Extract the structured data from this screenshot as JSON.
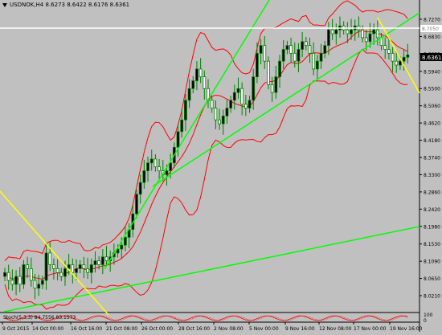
{
  "title": {
    "symbol": "USDNOK,H4",
    "ohlc": "8.6273 8.6422 8.6176 8.6361"
  },
  "indicator_label": "Stoch(5,3,3) 84.7556 83.1573",
  "current_price": "8.6361",
  "hline_price_label": "8.7050",
  "colors": {
    "background": "#c0c0c0",
    "candle": "#008000",
    "band": "#ff0000",
    "trend_green": "#00ff00",
    "trend_yellow": "#ffff00",
    "hline": "#ffffff",
    "price_tag": "#000000"
  },
  "chart_data": {
    "type": "candlestick",
    "title": "USDNOK,H4",
    "ylim": [
      6.0,
      8.76
    ],
    "y_ticks": [
      "8.7270",
      "8.6830",
      "8.6390",
      "8.5940",
      "8.5500",
      "8.5060",
      "8.4620",
      "8.4180",
      "8.3740",
      "8.3300",
      "8.2860",
      "8.2420",
      "8.1980",
      "8.1530",
      "8.1090",
      "8.0650",
      "8.0210"
    ],
    "x_ticks": [
      "9 Oct 2015",
      "14 Oct 00:00",
      "16 Oct 16:00",
      "21 Oct 08:00",
      "26 Oct 00:00",
      "28 Oct 16:00",
      "2 Nov 08:00",
      "5 Nov 00:00",
      "9 Nov 16:00",
      "12 Nov 08:00",
      "17 Nov 00:00",
      "19 Nov 16:00"
    ],
    "sub_ticks": [
      "100",
      "0"
    ],
    "current": 8.6361,
    "hline": 8.705,
    "close_series": [
      8.08,
      8.06,
      8.05,
      8.07,
      8.05,
      8.1,
      8.09,
      8.06,
      8.04,
      8.05,
      8.06,
      8.13,
      8.1,
      8.09,
      8.08,
      8.07,
      8.09,
      8.1,
      8.08,
      8.09,
      8.1,
      8.09,
      8.08,
      8.1,
      8.11,
      8.1,
      8.12,
      8.11,
      8.12,
      8.13,
      8.14,
      8.15,
      8.17,
      8.19,
      8.23,
      8.28,
      8.31,
      8.34,
      8.36,
      8.37,
      8.35,
      8.34,
      8.33,
      8.34,
      8.36,
      8.4,
      8.44,
      8.47,
      8.52,
      8.55,
      8.57,
      8.6,
      8.58,
      8.55,
      8.52,
      8.5,
      8.47,
      8.46,
      8.48,
      8.5,
      8.52,
      8.54,
      8.55,
      8.51,
      8.5,
      8.52,
      8.58,
      8.64,
      8.66,
      8.62,
      8.56,
      8.54,
      8.58,
      8.62,
      8.65,
      8.66,
      8.64,
      8.62,
      8.65,
      8.67,
      8.66,
      8.64,
      8.6,
      8.62,
      8.64,
      8.66,
      8.7,
      8.69,
      8.7,
      8.71,
      8.7,
      8.69,
      8.7,
      8.71,
      8.7,
      8.68,
      8.67,
      8.69,
      8.7,
      8.68,
      8.66,
      8.65,
      8.64,
      8.62,
      8.61,
      8.62,
      8.63,
      8.6361
    ]
  }
}
